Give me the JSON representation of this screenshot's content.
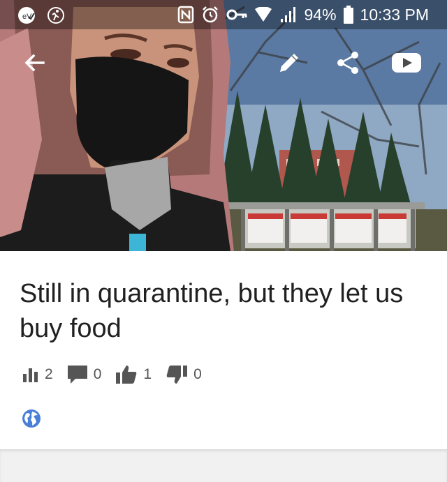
{
  "status_bar": {
    "left_icons": [
      "vpn-check-icon",
      "activity-icon"
    ],
    "right_icons": [
      "nfc-icon",
      "alarm-icon",
      "key-icon",
      "wifi-icon",
      "signal-icon"
    ],
    "battery": "94%",
    "time": "10:33 PM"
  },
  "toolbar": {
    "icons": [
      "back-arrow-icon",
      "edit-pencil-icon",
      "share-icon",
      "youtube-icon"
    ]
  },
  "post": {
    "title": "Still in quarantine, but they let us buy food",
    "stats": {
      "views": "2",
      "comments": "0",
      "likes": "1",
      "dislikes": "0"
    },
    "visibility_icon": "globe-icon"
  },
  "colors": {
    "accent_blue": "#4a7fd8",
    "icon_gray": "#555555",
    "title_text": "#202020"
  }
}
